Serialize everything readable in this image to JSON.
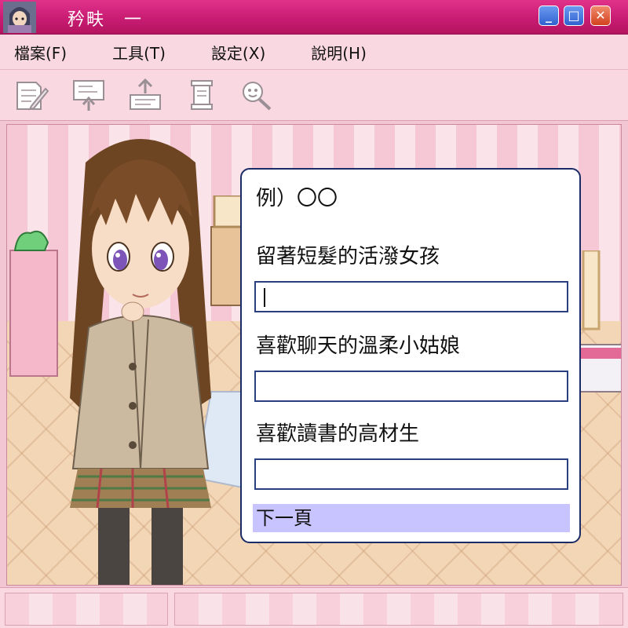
{
  "window": {
    "title": "矜畉　一",
    "minimize_label": "_",
    "maximize_label": "□",
    "close_label": "✕"
  },
  "menu": {
    "items": [
      {
        "label": "檔案(F)"
      },
      {
        "label": "工具(T)"
      },
      {
        "label": "設定(X)"
      },
      {
        "label": "說明(H)"
      }
    ]
  },
  "toolbar": {
    "tools": [
      {
        "icon": "edit-document-icon"
      },
      {
        "icon": "board-upload-icon"
      },
      {
        "icon": "send-upload-icon"
      },
      {
        "icon": "lantern-scroll-icon"
      },
      {
        "icon": "magnifier-character-icon"
      }
    ]
  },
  "dialog": {
    "example": "例）〇〇",
    "fields": [
      {
        "label": "留著短髮的活潑女孩",
        "value": ""
      },
      {
        "label": "喜歡聊天的溫柔小姑娘",
        "value": ""
      },
      {
        "label": "喜歡讀書的高材生",
        "value": ""
      }
    ],
    "next_label": "下一頁"
  },
  "colors": {
    "titlebar": "#c81c73",
    "menubar": "#f9d8e2",
    "dialog_border": "#1b2b66",
    "next_highlight": "#c7c4ff"
  }
}
